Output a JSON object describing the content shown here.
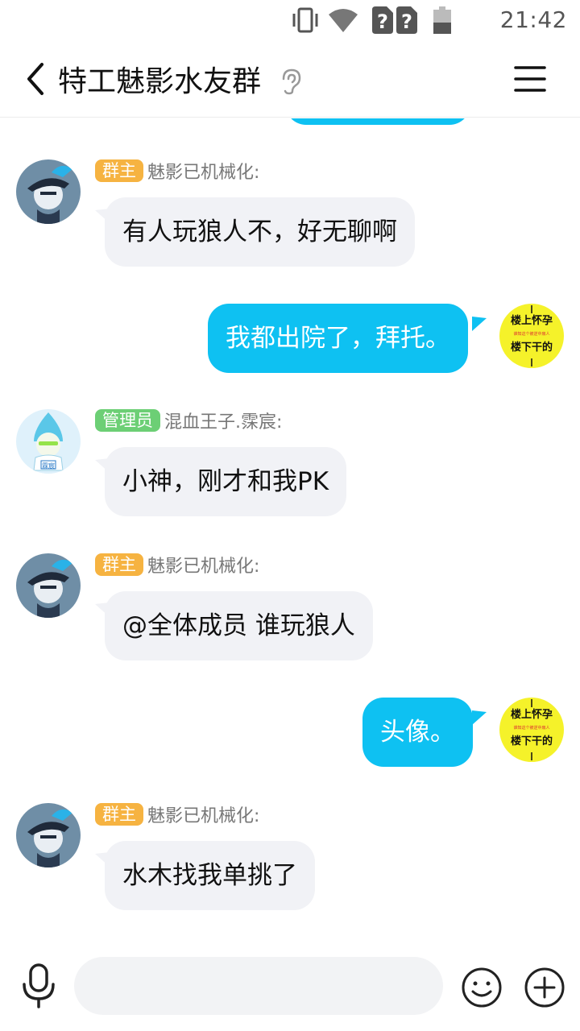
{
  "status_bar": {
    "time": "21:42",
    "icons": [
      "vibrate-icon",
      "wifi-icon",
      "sim-unknown-icon",
      "sim-unknown-icon",
      "battery-low-icon"
    ]
  },
  "header": {
    "back_icon": "chevron-left-icon",
    "title": "特工魅影水友群",
    "ear_icon": "earpiece-icon",
    "menu_icon": "menu-icon"
  },
  "messages": [
    {
      "direction": "in",
      "role": "群主",
      "sender": "魅影已机械化:",
      "text": "有人玩狼人不，好无聊啊",
      "avatar": "pirate-avatar"
    },
    {
      "direction": "out",
      "text": "我都出院了，拜托。",
      "avatar": "sticker-avatar",
      "sticker": {
        "top": "楼上怀孕",
        "middle": "谁知这个被逆中扇人",
        "bottom": "楼下干的"
      }
    },
    {
      "direction": "in",
      "role": "管理员",
      "sender": "混血王子.霂宸:",
      "text": "小神，刚才和我PK",
      "avatar": "chibi-avatar",
      "avatar_tag": "霖宸"
    },
    {
      "direction": "in",
      "role": "群主",
      "sender": "魅影已机械化:",
      "text": "@全体成员 谁玩狼人",
      "avatar": "pirate-avatar"
    },
    {
      "direction": "out",
      "text": "头像。",
      "avatar": "sticker-avatar",
      "sticker": {
        "top": "楼上怀孕",
        "middle": "谁知这个被逆中扇人",
        "bottom": "楼下干的"
      }
    },
    {
      "direction": "in",
      "role": "群主",
      "sender": "魅影已机械化:",
      "text": "水木找我单挑了",
      "avatar": "pirate-avatar"
    }
  ],
  "input_bar": {
    "voice_icon": "microphone-icon",
    "placeholder": "",
    "emoji_icon": "smiley-icon",
    "plus_icon": "plus-circle-icon"
  },
  "colors": {
    "out_bubble": "#0ec1f2",
    "in_bubble": "#f1f2f6",
    "owner_badge": "#f6b341",
    "admin_badge": "#6ccf75",
    "sticker_bg": "#f5f22a"
  }
}
